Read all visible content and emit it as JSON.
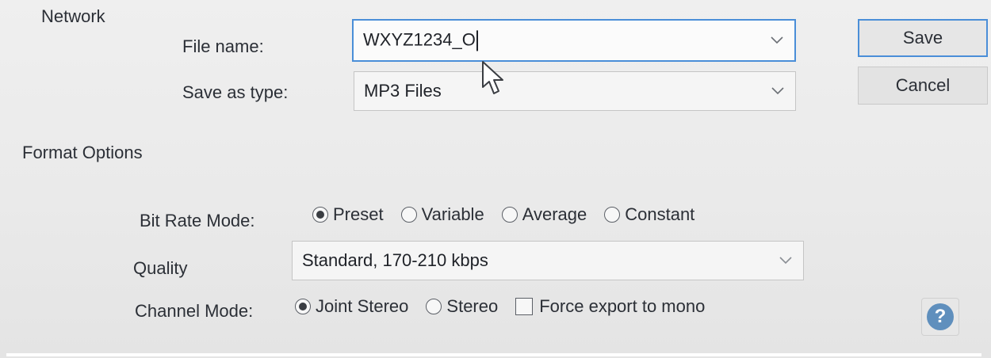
{
  "header": {
    "network_label": "Network"
  },
  "file": {
    "name_label": "File name:",
    "name_value": "WXYZ1234_O",
    "type_label": "Save as type:",
    "type_value": "MP3 Files"
  },
  "buttons": {
    "save": "Save",
    "cancel": "Cancel"
  },
  "format": {
    "title": "Format Options",
    "bit_rate_label": "Bit Rate Mode:",
    "bit_rate_options": [
      {
        "label": "Preset",
        "checked": true
      },
      {
        "label": "Variable",
        "checked": false
      },
      {
        "label": "Average",
        "checked": false
      },
      {
        "label": "Constant",
        "checked": false
      }
    ],
    "quality_label": "Quality",
    "quality_value": "Standard, 170-210 kbps",
    "channel_label": "Channel Mode:",
    "channel_options": [
      {
        "label": "Joint Stereo",
        "checked": true
      },
      {
        "label": "Stereo",
        "checked": false
      }
    ],
    "mono_label": "Force export to mono",
    "mono_checked": false
  },
  "help": {
    "glyph": "?"
  },
  "colors": {
    "focus_border": "#4a8ed8",
    "help_icon": "#5f8fbd"
  },
  "icons": [
    "chevron-down-icon",
    "radio-icon",
    "checkbox-icon",
    "help-icon",
    "mouse-cursor-icon"
  ]
}
